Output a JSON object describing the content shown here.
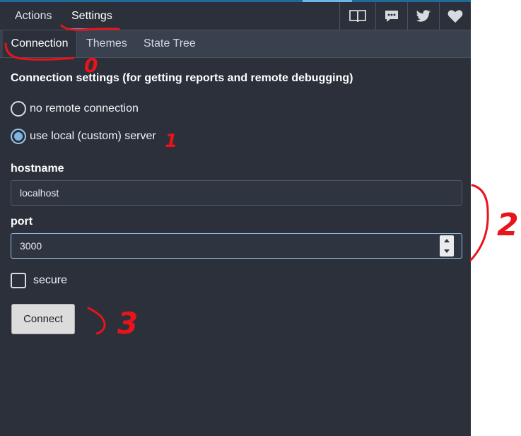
{
  "top_tabs": {
    "actions": "Actions",
    "settings": "Settings"
  },
  "top_icons": [
    "book-icon",
    "chat-icon",
    "twitter-icon",
    "heart-icon"
  ],
  "sub_tabs": {
    "connection": "Connection",
    "themes": "Themes",
    "state_tree": "State Tree"
  },
  "connection": {
    "title": "Connection settings (for getting reports and remote debugging)",
    "options": [
      "no remote connection",
      "use local (custom) server"
    ],
    "selected_option": "use local (custom) server",
    "hostname_label": "hostname",
    "hostname_value": "localhost",
    "port_label": "port",
    "port_value": "3000",
    "secure_label": "secure",
    "secure_checked": false,
    "connect_label": "Connect"
  },
  "annotations": {
    "mark_1": "0",
    "mark_2": "1",
    "mark_3": "2",
    "mark_4": "3"
  },
  "colors": {
    "panel": "#2b303b",
    "sub_bar": "#3a414e",
    "accent": "#5aa8dd",
    "annotation": "#e8141a"
  }
}
